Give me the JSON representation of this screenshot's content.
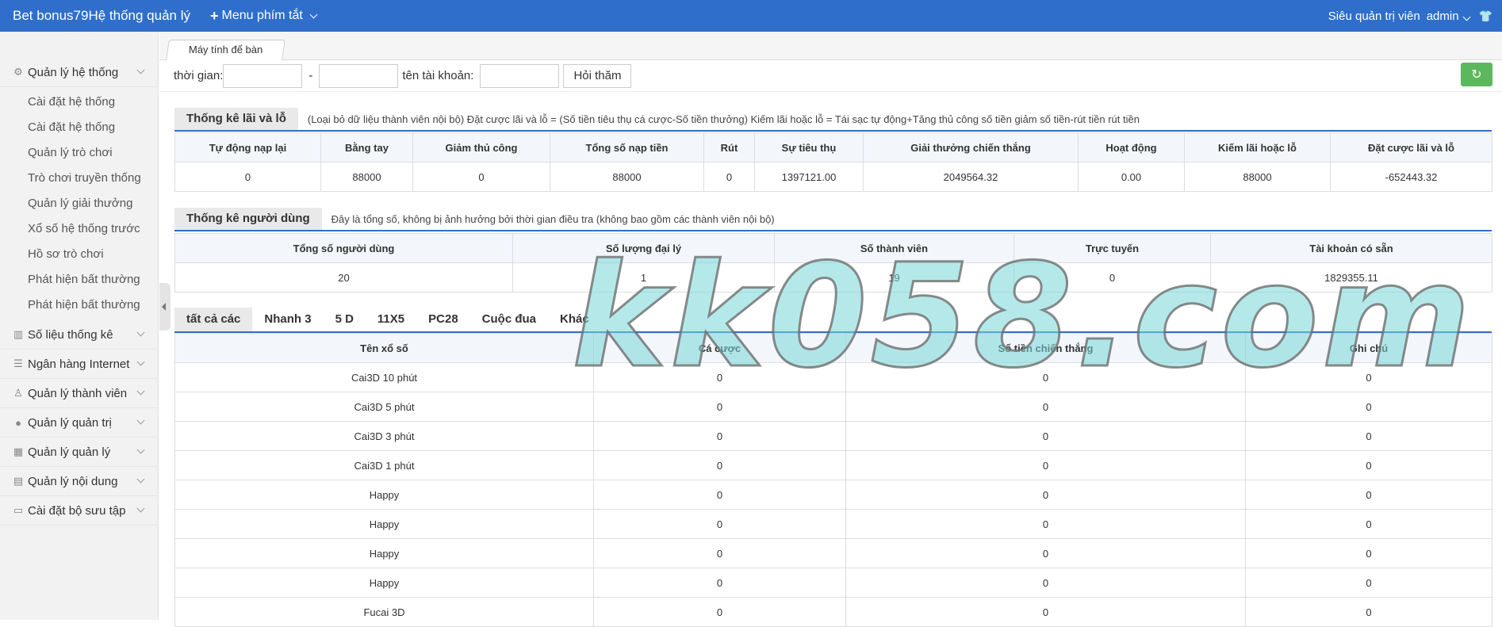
{
  "header": {
    "brand": "Bet bonus79Hệ thống quản lý",
    "menu_label": "Menu phím tắt",
    "role": "Siêu quản trị viên",
    "user": "admin"
  },
  "sidebar": {
    "sections": [
      {
        "label": "Quản lý hệ thống",
        "icon": "gear-icon",
        "items": [
          "Cài đặt hệ thống",
          "Cài đặt hệ thống",
          "Quản lý trò chơi",
          "Trò chơi truyền thống",
          "Quản lý giải thưởng",
          "Xổ số hệ thống trước",
          "Hồ sơ trò chơi",
          "Phát hiện bất thường",
          "Phát hiện bất thường"
        ]
      },
      {
        "label": "Số liệu thống kê",
        "icon": "chart-icon"
      },
      {
        "label": "Ngân hàng Internet",
        "icon": "list-icon"
      },
      {
        "label": "Quản lý thành viên",
        "icon": "user-icon"
      },
      {
        "label": "Quản lý quản trị",
        "icon": "admin-icon"
      },
      {
        "label": "Quản lý quản lý",
        "icon": "calendar-icon"
      },
      {
        "label": "Quản lý nội dung",
        "icon": "document-icon"
      },
      {
        "label": "Cài đặt bộ sưu tập",
        "icon": "card-icon"
      }
    ]
  },
  "tabs": {
    "home": "Máy tính để bàn"
  },
  "filter": {
    "time_label": "thời gian:",
    "separator": "-",
    "account_label": "tên tài khoản:",
    "query_button": "Hỏi thăm"
  },
  "profit": {
    "title": "Thống kê lãi và lỗ",
    "note": "(Loại bỏ dữ liệu thành viên nội bộ)  Đặt cược lãi và lỗ = (Số tiền tiêu thụ cá cược-Số tiền thưởng)    Kiếm lãi hoặc lỗ = Tái sạc tự động+Tăng thủ công số tiền giảm số tiền-rút tiền rút tiền",
    "headers": [
      "Tự động nạp lại",
      "Bằng tay",
      "Giảm thủ công",
      "Tổng số nạp tiền",
      "Rút",
      "Sự tiêu thụ",
      "Giải thưởng chiến thắng",
      "Hoạt động",
      "Kiếm lãi hoặc lỗ",
      "Đặt cược lãi và lỗ"
    ],
    "values": [
      "0",
      "88000",
      "0",
      "88000",
      "0",
      "1397121.00",
      "2049564.32",
      "0.00",
      "88000",
      "-652443.32"
    ]
  },
  "users": {
    "title": "Thống kê người dùng",
    "note": "Đây là tổng số, không bị ảnh hưởng bởi thời gian điều tra (không bao gồm các thành viên nội bộ)",
    "headers": [
      "Tổng số người dùng",
      "Số lượng đại lý",
      "Số thành viên",
      "Trực tuyến",
      "Tài khoản có sẵn"
    ],
    "values": [
      "20",
      "1",
      "19",
      "0",
      "1829355.11"
    ]
  },
  "game_tabs": [
    "tất cả các",
    "Nhanh 3",
    "5 D",
    "11X5",
    "PC28",
    "Cuộc đua",
    "Khác"
  ],
  "lottery": {
    "headers": [
      "Tên xổ số",
      "Cá cược",
      "Số tiền chiến thắng",
      "Ghi chú"
    ],
    "rows": [
      [
        "Cai3D 10 phút",
        "0",
        "0",
        "0"
      ],
      [
        "Cai3D 5 phút",
        "0",
        "0",
        "0"
      ],
      [
        "Cai3D 3 phút",
        "0",
        "0",
        "0"
      ],
      [
        "Cai3D 1 phút",
        "0",
        "0",
        "0"
      ],
      [
        "Happy",
        "0",
        "0",
        "0"
      ],
      [
        "Happy",
        "0",
        "0",
        "0"
      ],
      [
        "Happy",
        "0",
        "0",
        "0"
      ],
      [
        "Happy",
        "0",
        "0",
        "0"
      ],
      [
        "Fucai 3D",
        "0",
        "0",
        "0"
      ]
    ]
  },
  "watermark": "kk058.com"
}
